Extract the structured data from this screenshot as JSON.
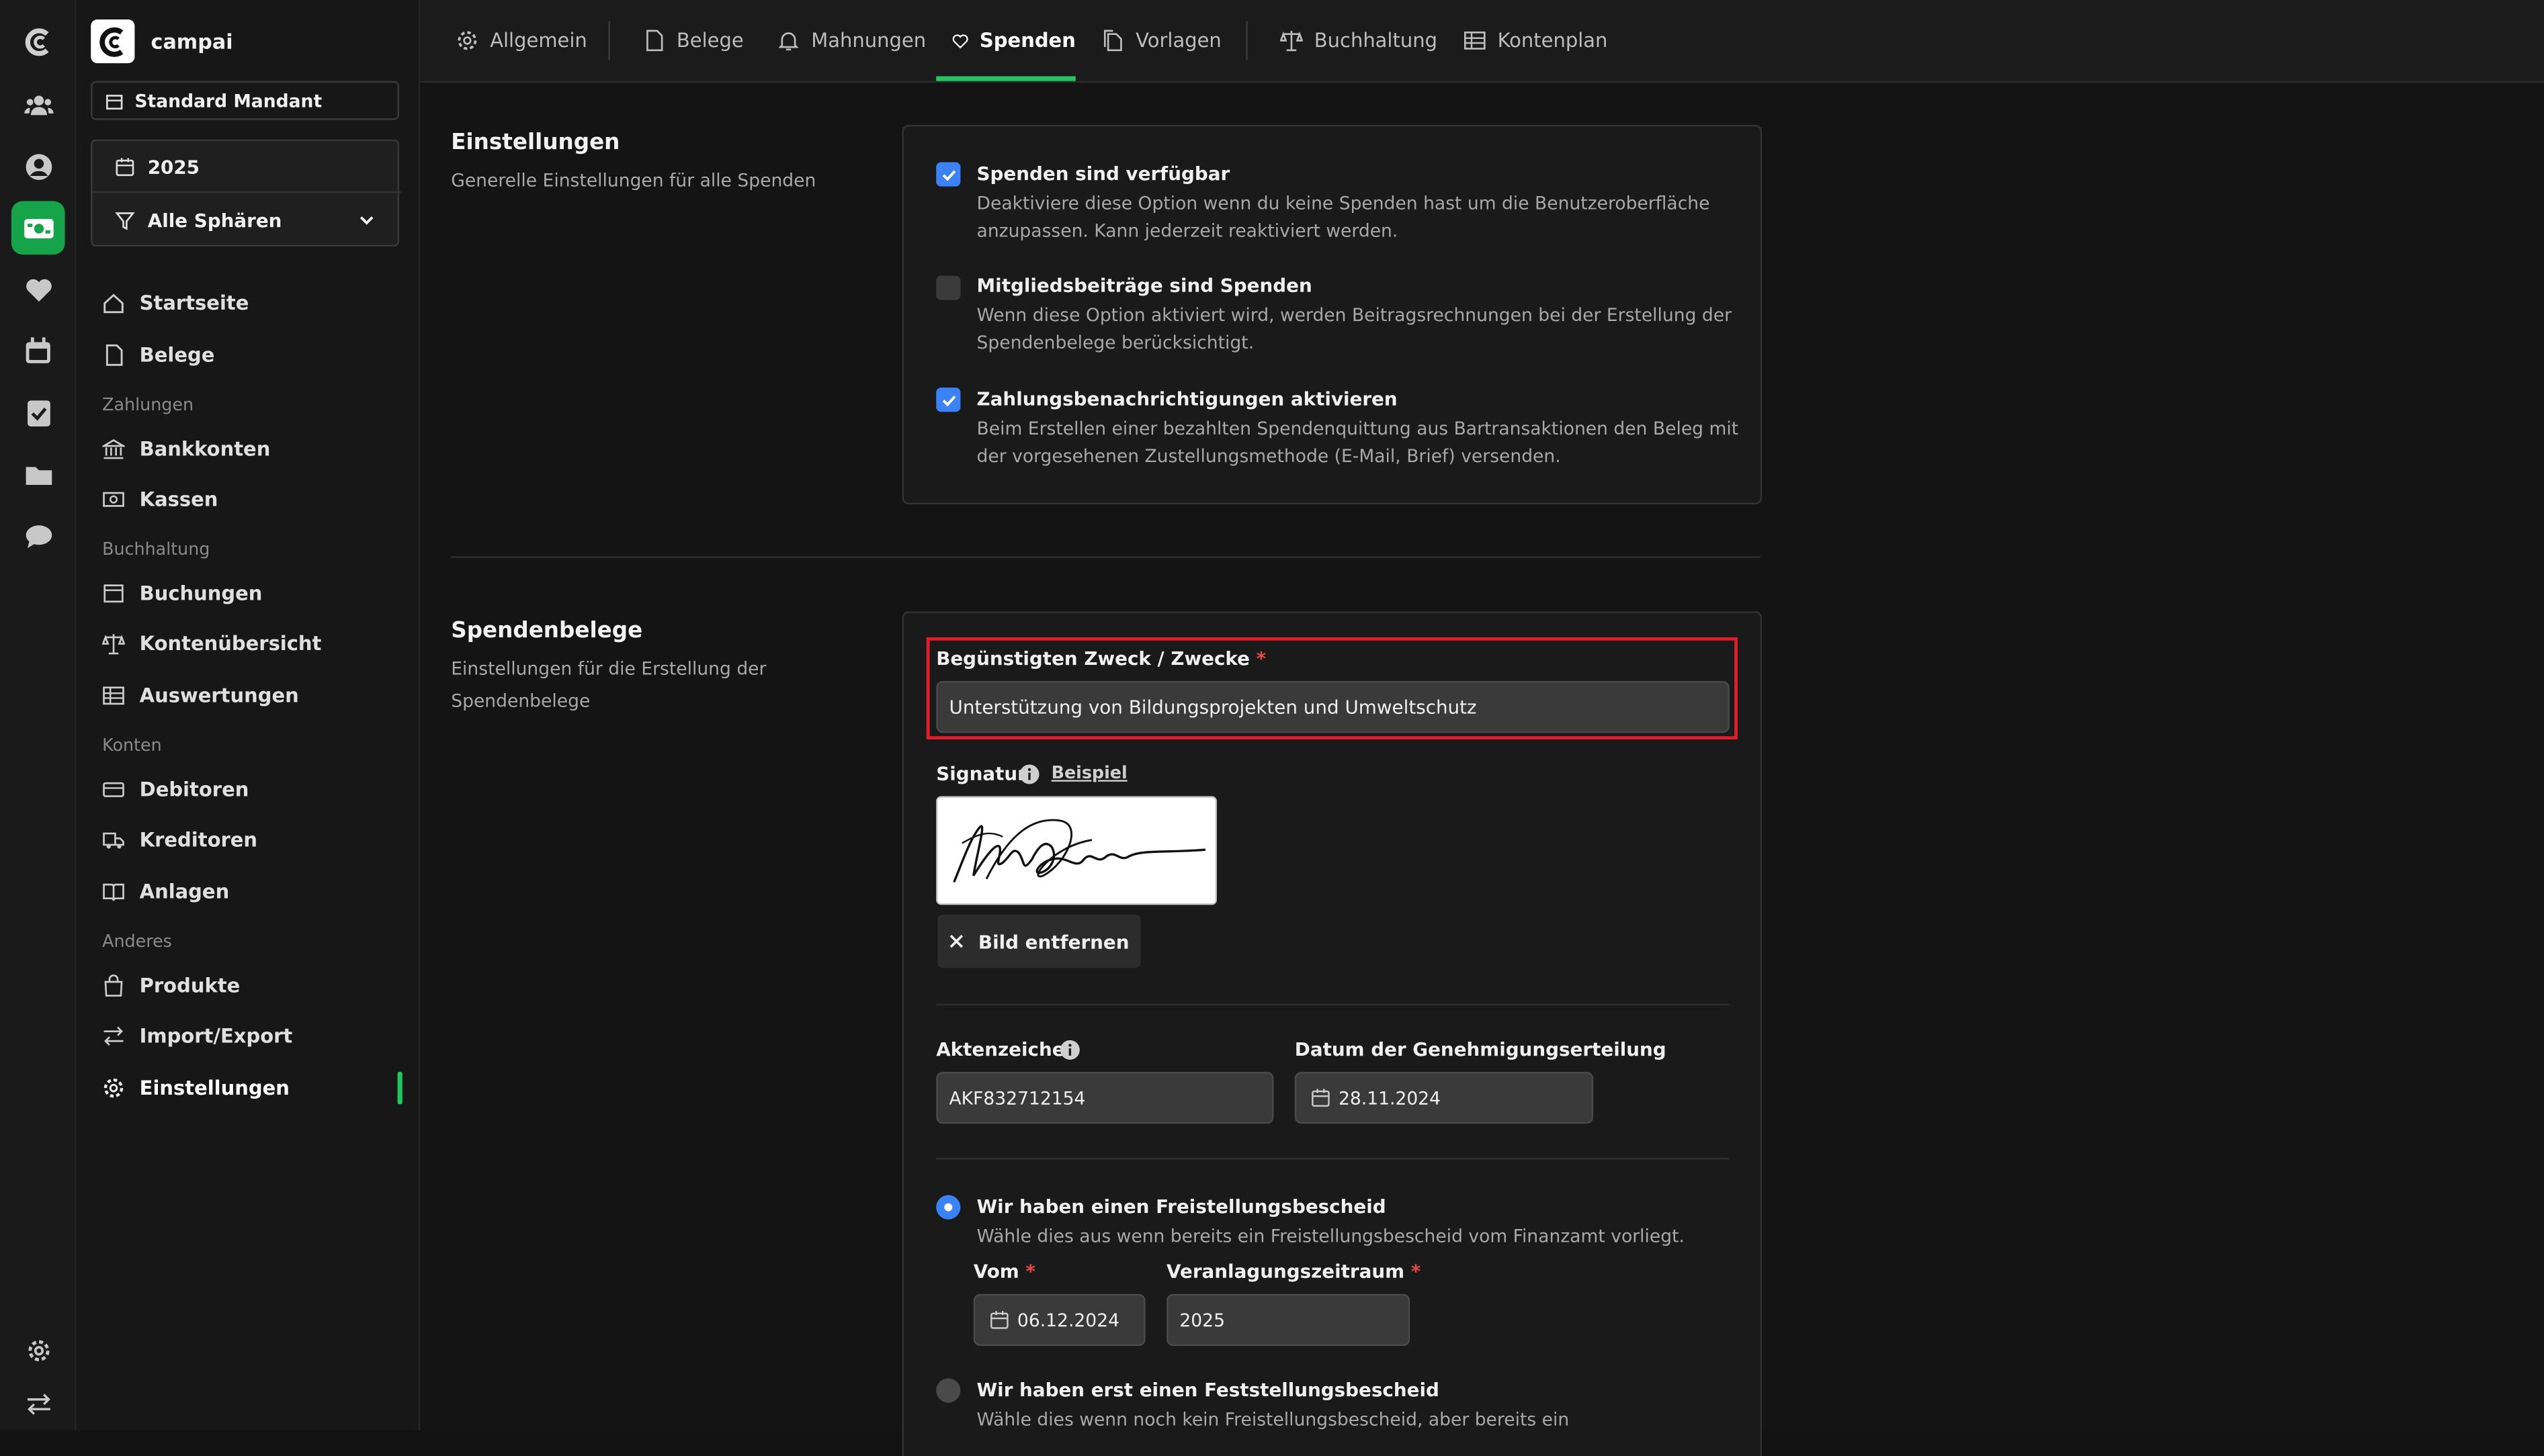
{
  "app": {
    "name": "campai"
  },
  "mandant": {
    "label": "Standard Mandant"
  },
  "year": {
    "label": "2025"
  },
  "sphere": {
    "label": "Alle Sphären"
  },
  "sidebar": {
    "startseite": "Startseite",
    "belege": "Belege",
    "section_zahlungen": "Zahlungen",
    "bankkonten": "Bankkonten",
    "kassen": "Kassen",
    "section_buchhaltung": "Buchhaltung",
    "buchungen": "Buchungen",
    "kontenuebersicht": "Kontenübersicht",
    "auswertungen": "Auswertungen",
    "section_konten": "Konten",
    "debitoren": "Debitoren",
    "kreditoren": "Kreditoren",
    "anlagen": "Anlagen",
    "section_anderes": "Anderes",
    "produkte": "Produkte",
    "import_export": "Import/Export",
    "einstellungen": "Einstellungen"
  },
  "tabs": {
    "allgemein": "Allgemein",
    "belege": "Belege",
    "mahnungen": "Mahnungen",
    "spenden": "Spenden",
    "vorlagen": "Vorlagen",
    "buchhaltung": "Buchhaltung",
    "kontenplan": "Kontenplan"
  },
  "settings": {
    "title": "Einstellungen",
    "subtitle": "Generelle Einstellungen für alle Spenden",
    "opt1_title": "Spenden sind verfügbar",
    "opt1_desc": "Deaktiviere diese Option wenn du keine Spenden hast um die Benutzeroberfläche anzupassen. Kann jederzeit reaktiviert werden.",
    "opt1_checked": true,
    "opt2_title": "Mitgliedsbeiträge sind Spenden",
    "opt2_desc": "Wenn diese Option aktiviert wird, werden Beitragsrechnungen bei der Erstellung der Spendenbelege berücksichtigt.",
    "opt2_checked": false,
    "opt3_title": "Zahlungsbenachrichtigungen aktivieren",
    "opt3_desc": "Beim Erstellen einer bezahlten Spendenquittung aus Bartransaktionen den Beleg mit der vorgesehenen Zustellungsmethode (E-Mail, Brief) versenden.",
    "opt3_checked": true
  },
  "receipts": {
    "title": "Spendenbelege",
    "subtitle": "Einstellungen für die Erstellung der Spendenbelege",
    "purpose_label": "Begünstigten Zweck / Zwecke",
    "required_mark": "*",
    "purpose_value": "Unterstützung von Bildungsprojekten und Umweltschutz",
    "signature_label": "Signatur",
    "signature_example": "Beispiel",
    "remove_image": "Bild entfernen",
    "aktenzeichen_label": "Aktenzeichen",
    "aktenzeichen_value": "AKF832712154",
    "date_label": "Datum der Genehmigungserteilung",
    "date_value": "28.11.2024",
    "radio1_title": "Wir haben einen Freistellungsbescheid",
    "radio1_desc": "Wähle dies aus wenn bereits ein Freistellungsbescheid vom Finanzamt vorliegt.",
    "vom_label": "Vom",
    "vom_value": "06.12.2024",
    "zeitraum_label": "Veranlagungszeitraum",
    "zeitraum_value": "2025",
    "radio2_title": "Wir haben erst einen Feststellungsbescheid",
    "radio2_desc": "Wähle dies wenn noch kein Freistellungsbescheid, aber bereits ein"
  },
  "colors": {
    "accent": "#22c55e",
    "checkbox": "#3b82f6",
    "highlight": "#e11d2a"
  }
}
